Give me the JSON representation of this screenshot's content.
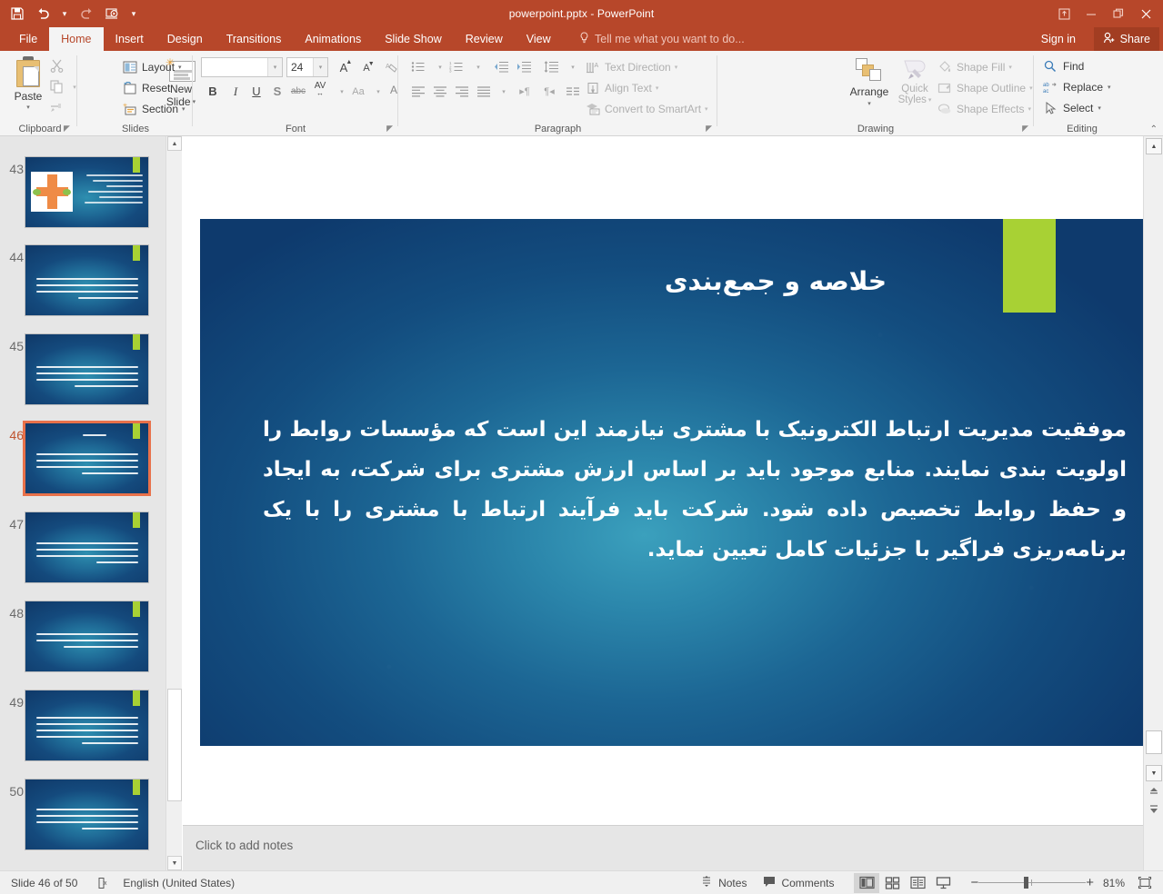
{
  "window": {
    "title": "powerpoint.pptx - PowerPoint",
    "quick_access": [
      "save-icon",
      "undo-icon",
      "redo-icon",
      "start-from-beginning-icon",
      "customize-icon"
    ],
    "controls": {
      "ribbon_display": "⤒",
      "minimize": "–",
      "restore": "❐",
      "close": "✕"
    }
  },
  "tabs": [
    {
      "label": "File",
      "active": false
    },
    {
      "label": "Home",
      "active": true
    },
    {
      "label": "Insert",
      "active": false
    },
    {
      "label": "Design",
      "active": false
    },
    {
      "label": "Transitions",
      "active": false
    },
    {
      "label": "Animations",
      "active": false
    },
    {
      "label": "Slide Show",
      "active": false
    },
    {
      "label": "Review",
      "active": false
    },
    {
      "label": "View",
      "active": false
    }
  ],
  "tellme": {
    "placeholder": "Tell me what you want to do..."
  },
  "account": {
    "signin": "Sign in",
    "share": "Share"
  },
  "ribbon": {
    "clipboard": {
      "group_label": "Clipboard",
      "paste": "Paste",
      "cut": "cut-icon",
      "copy": "copy-icon",
      "format_painter": "format-painter-icon"
    },
    "slides": {
      "group_label": "Slides",
      "new_slide": "New Slide",
      "layout": "Layout",
      "reset": "Reset",
      "section": "Section"
    },
    "font": {
      "group_label": "Font",
      "font_name": "",
      "font_name_placeholder": "",
      "font_size": "24",
      "increase_size": "A",
      "decrease_size": "A",
      "clear_formatting": "clear-formatting-icon",
      "bold": "B",
      "italic": "I",
      "underline": "U",
      "shadow": "S",
      "strikethrough": "abc",
      "character_spacing": "AV",
      "change_case": "Aa",
      "font_color": "A"
    },
    "paragraph": {
      "group_label": "Paragraph",
      "bullets": "bullets-icon",
      "numbering": "numbering-icon",
      "decrease_indent": "decrease-indent-icon",
      "increase_indent": "increase-indent-icon",
      "line_spacing": "line-spacing-icon",
      "align_left": "align-left-icon",
      "align_center": "align-center-icon",
      "align_right": "align-right-icon",
      "justify": "justify-icon",
      "ltr": "left-to-right-icon",
      "rtl": "right-to-left-icon",
      "columns": "columns-icon",
      "text_direction": "Text Direction",
      "align_text": "Align Text",
      "convert_smartart": "Convert to SmartArt"
    },
    "drawing": {
      "group_label": "Drawing",
      "arrange": "Arrange",
      "quick_styles": "Quick Styles",
      "shape_fill": "Shape Fill",
      "shape_outline": "Shape Outline",
      "shape_effects": "Shape Effects",
      "shapes": [
        "textbox",
        "line",
        "arrow",
        "rectangle",
        "oval",
        "rounded-rect",
        "triangle",
        "elbow",
        "elbow-arrow",
        "right-arrow",
        "down-arrow",
        "pentagon",
        "scribble",
        "arc",
        "curve",
        "left-brace",
        "right-brace",
        "star"
      ]
    },
    "editing": {
      "group_label": "Editing",
      "find": "Find",
      "replace": "Replace",
      "select": "Select"
    }
  },
  "slides_pane": {
    "thumbnails": [
      {
        "number": "43",
        "selected": false,
        "kind": "diagram",
        "lines": 6
      },
      {
        "number": "44",
        "selected": false,
        "kind": "text",
        "lines": 4
      },
      {
        "number": "45",
        "selected": false,
        "kind": "text",
        "lines": 4
      },
      {
        "number": "46",
        "selected": true,
        "kind": "title-text",
        "lines": 4
      },
      {
        "number": "47",
        "selected": false,
        "kind": "text",
        "lines": 4
      },
      {
        "number": "48",
        "selected": false,
        "kind": "text",
        "lines": 3
      },
      {
        "number": "49",
        "selected": false,
        "kind": "text",
        "lines": 5
      },
      {
        "number": "50",
        "selected": false,
        "kind": "text",
        "lines": 4
      }
    ]
  },
  "slide": {
    "title": "خلاصه و جمع‌بندی",
    "body": "موفقیت مدیریت ارتباط الکترونیک با مشتری نیازمند این است که مؤسسات روابط را اولویت بندی نمایند. منابع موجود باید بر اساس ارزش مشتری برای شرکت، به ایجاد و حفظ روابط تخصیص داده شود. شرکت باید فرآیند ارتباط با مشتری را با یک برنامه‌ریزی فراگیر با جزئیات کامل تعیین نماید.",
    "accent_color": "#a8d134",
    "background_colors": [
      "#3ba0bd",
      "#0e3a6d"
    ]
  },
  "notes": {
    "placeholder": "Click to add notes"
  },
  "statusbar": {
    "slide_counter": "Slide 46 of 50",
    "language": "English (United States)",
    "notes": "Notes",
    "comments": "Comments",
    "views": [
      "normal-view",
      "slide-sorter-view",
      "reading-view",
      "slide-show-view"
    ],
    "zoom_out": "−",
    "zoom_in": "+",
    "zoom_level": "81%",
    "fit_to_window": "fit-slide-icon"
  }
}
